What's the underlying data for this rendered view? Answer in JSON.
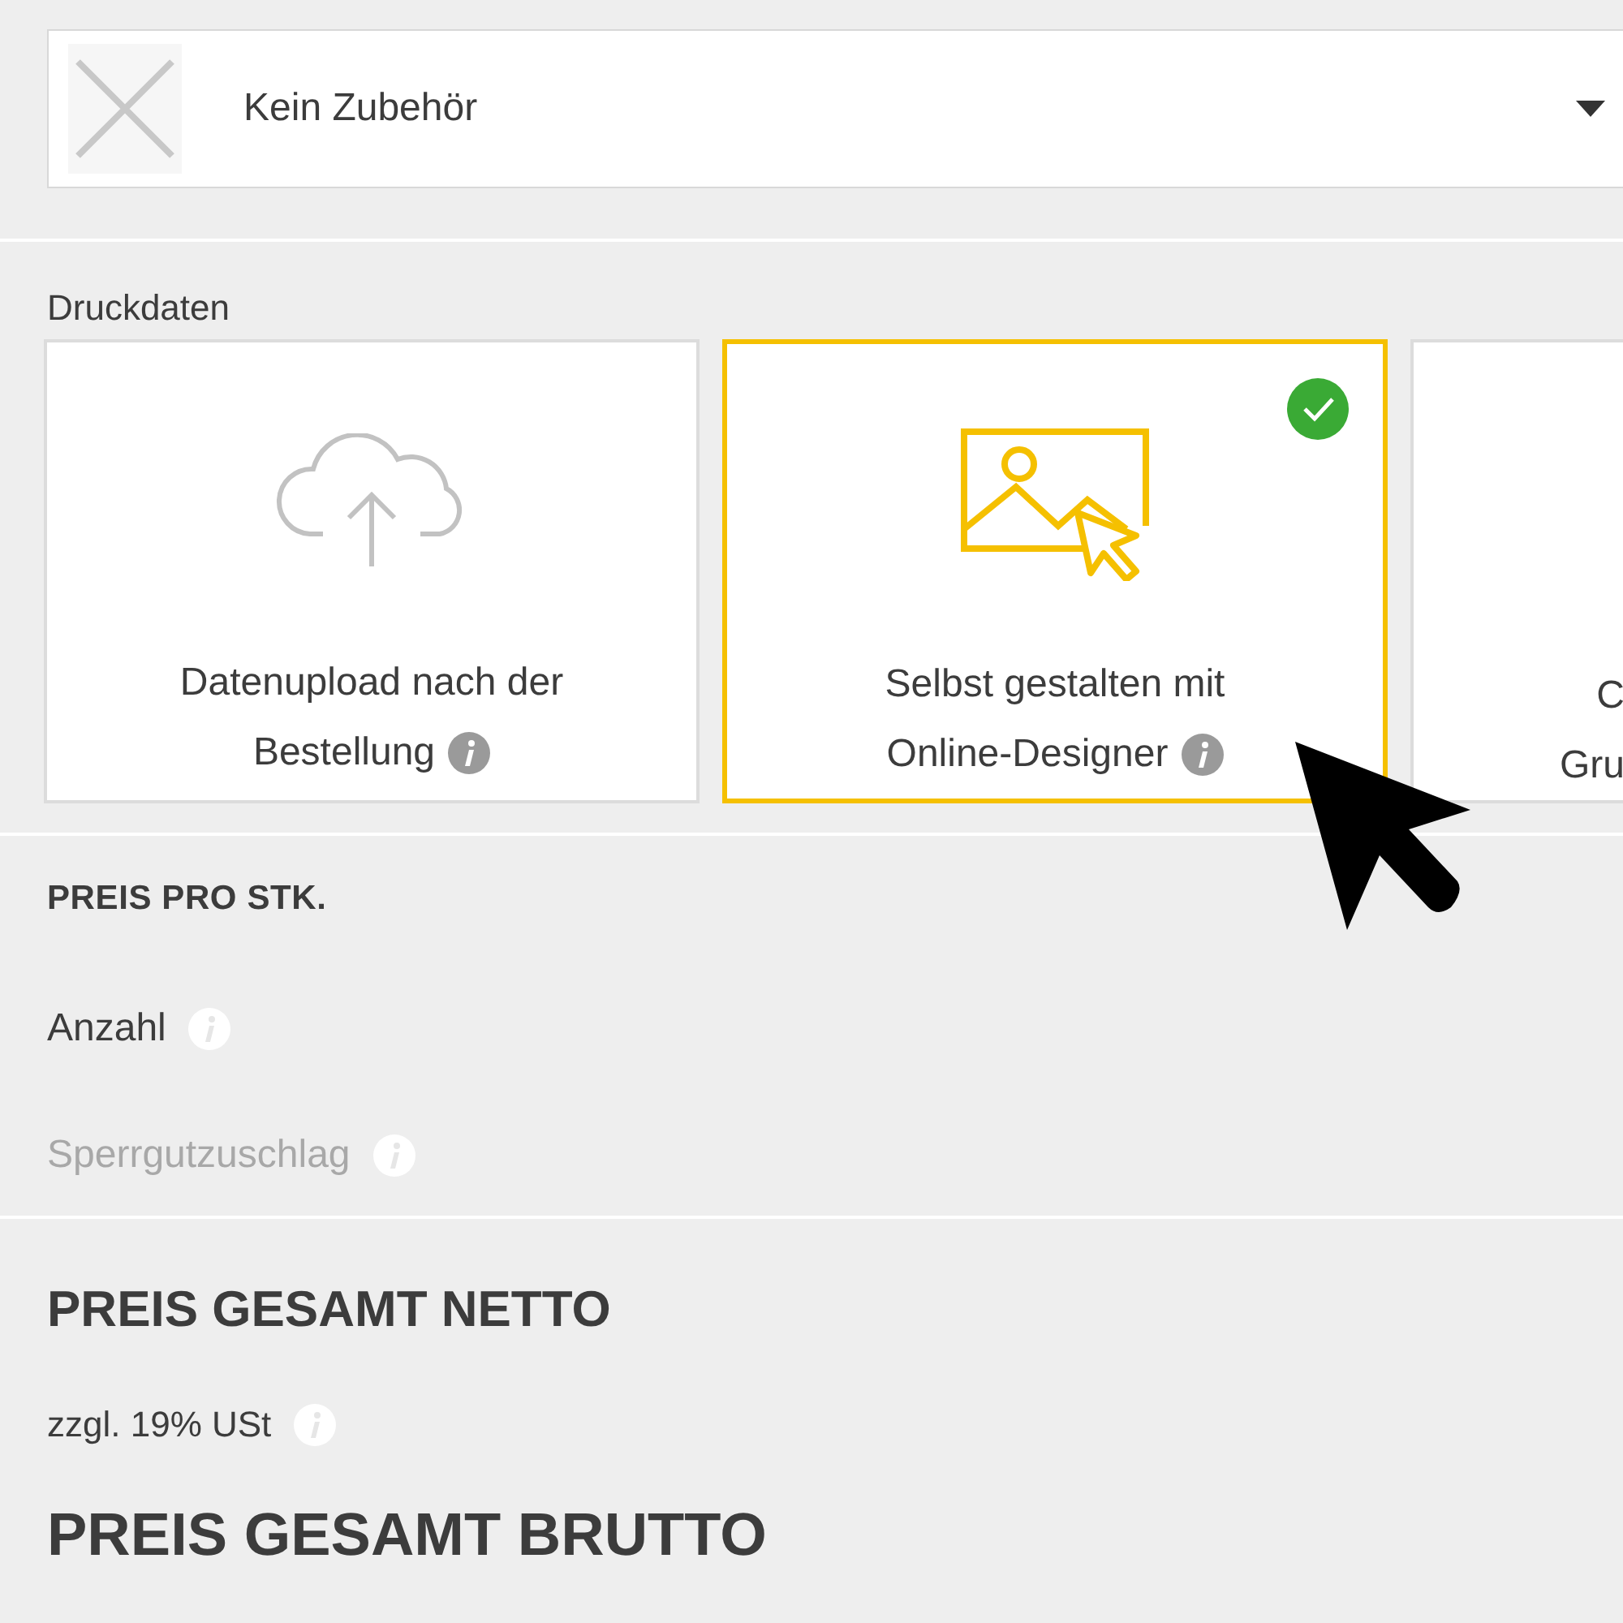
{
  "accessory_select": {
    "value": "Kein Zubehör"
  },
  "print_data": {
    "label": "Druckdaten",
    "options": [
      {
        "kind": "upload",
        "lines": [
          "Datenupload nach der",
          "Bestellung"
        ],
        "info": true,
        "selected": false
      },
      {
        "kind": "designer",
        "lines": [
          "Selbst gestalten mit",
          "Online-Designer"
        ],
        "info": true,
        "selected": true
      },
      {
        "kind": "partial",
        "lines": [
          "C",
          "Gru"
        ],
        "info": false,
        "selected": false
      }
    ]
  },
  "unit_price": {
    "heading": "PREIS PRO STK.",
    "rows": [
      {
        "label": "Anzahl",
        "disabled": false
      },
      {
        "label": "Sperrgutzuschlag",
        "disabled": true
      }
    ]
  },
  "total_net": {
    "heading": "PREIS GESAMT NETTO",
    "note": "zzgl. 19% USt"
  },
  "total_gross": {
    "heading": "PREIS GESAMT BRUTTO"
  }
}
